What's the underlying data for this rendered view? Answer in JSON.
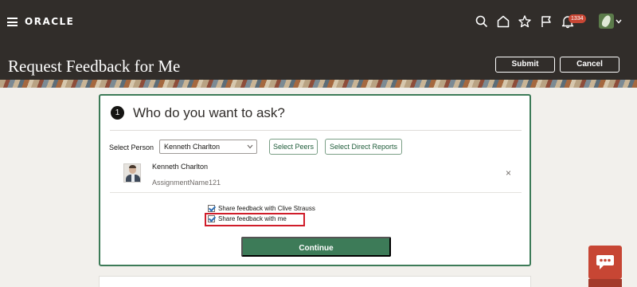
{
  "header": {
    "logo_text": "ORACLE",
    "notification_count": "1334",
    "page_title": "Request Feedback for Me",
    "submit_label": "Submit",
    "cancel_label": "Cancel"
  },
  "step": {
    "number": "1",
    "heading": "Who do you want to ask?"
  },
  "select_person": {
    "label": "Select Person",
    "value": "Kenneth Charlton",
    "select_peers_label": "Select Peers",
    "select_direct_reports_label": "Select Direct Reports"
  },
  "person": {
    "name": "Kenneth Charlton",
    "assignment": "AssignmentName121",
    "remove_glyph": "×"
  },
  "options": [
    {
      "label": "Share feedback with Clive Strauss",
      "checked": true
    },
    {
      "label": "Share feedback with me",
      "checked": true
    }
  ],
  "continue_label": "Continue",
  "colors": {
    "header_bg": "#312d2a",
    "accent_green": "#3d7b58",
    "badge_red": "#c74634",
    "highlight_red": "#d01d2a"
  },
  "icons": [
    "hamburger-icon",
    "search-icon",
    "home-icon",
    "star-icon",
    "flag-icon",
    "bell-icon",
    "chevron-down-icon",
    "close-icon",
    "chat-icon"
  ]
}
